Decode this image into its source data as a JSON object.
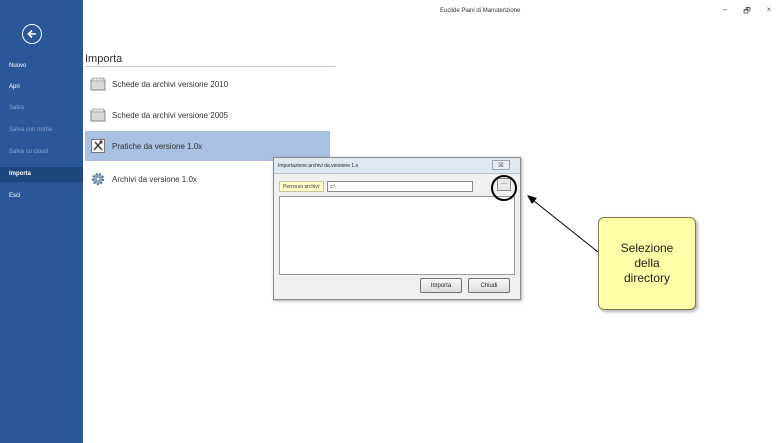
{
  "window": {
    "title": "Euclide Piani di Manutenzione",
    "minimize": "–",
    "maximize": "🗗",
    "close": "×"
  },
  "sidebar": {
    "items": [
      {
        "label": "Nuovo",
        "state": "normal"
      },
      {
        "label": "Apri",
        "state": "normal"
      },
      {
        "label": "Salva",
        "state": "disabled"
      },
      {
        "label": "Salva con nome",
        "state": "disabled"
      },
      {
        "label": "Salva su cloud",
        "state": "disabled"
      },
      {
        "label": "Importa",
        "state": "selected"
      },
      {
        "label": "Esci",
        "state": "normal"
      }
    ],
    "color": "#2b579a"
  },
  "main": {
    "title": "Importa",
    "items": [
      {
        "label": "Schede da archivi versione 2010",
        "icon": "binder-icon"
      },
      {
        "label": "Schede da archivi versione 2005",
        "icon": "binder-icon"
      },
      {
        "label": "Pratiche da versione 1.0x",
        "icon": "tools-icon",
        "selected": true
      },
      {
        "label": "Archivi da versione 1.0x",
        "icon": "gear-icon"
      }
    ]
  },
  "dialog": {
    "title": "Importazione archivi da versione 1.x",
    "close": "☒",
    "path_label": "Percorso archivi:",
    "path_value": "c:\\",
    "browse_label": "...",
    "import_button": "Importa",
    "close_button": "Chiudi"
  },
  "callout": {
    "text": "Selezione\ndella\ndirectory",
    "color": "#ffffa8"
  }
}
